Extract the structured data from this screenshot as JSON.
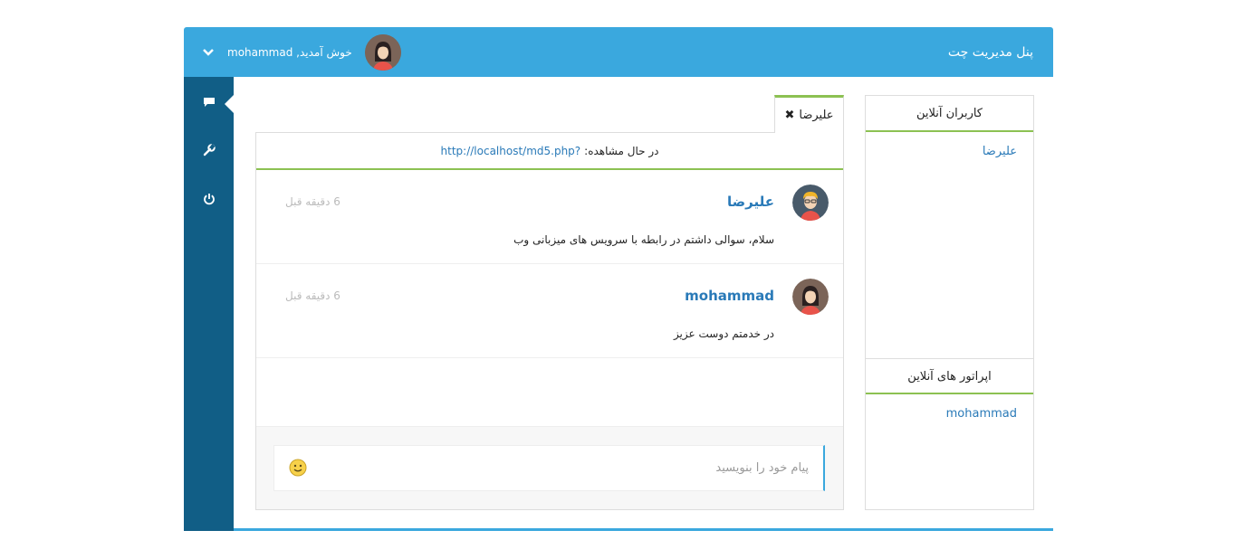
{
  "header": {
    "brand": "پنل مدیریت چت",
    "welcome": "خوش آمدید, mohammad"
  },
  "icons": {
    "menu": "chevron-down-icon",
    "chat": "comment-icon",
    "settings": "wrench-icon",
    "logout": "power-icon",
    "close": "close-icon",
    "emoji": "smiley-icon"
  },
  "colors": {
    "topbar": "#3aa8de",
    "sidebar": "#115e86",
    "accent_green": "#8cc152",
    "link": "#2a7ab8"
  },
  "online_users": {
    "title": "کاربران آنلاین",
    "users": [
      "علیرضا"
    ]
  },
  "online_operators": {
    "title": "اپراتور های آنلاین",
    "operators": [
      "mohammad"
    ]
  },
  "chat": {
    "tab_label": "علیرضا",
    "viewing_label": "در حال مشاهده:",
    "viewing_url": "http://localhost/md5.php?",
    "messages": [
      {
        "name": "علیرضا",
        "time": "6 دقیقه قبل",
        "text": "سلام، سوالی داشتم در رابطه با سرویس های میزبانی وب"
      },
      {
        "name": "mohammad",
        "time": "6 دقیقه قبل",
        "text": "در خدمتم دوست عزیز"
      }
    ],
    "input_placeholder": "پیام خود را بنویسید"
  }
}
